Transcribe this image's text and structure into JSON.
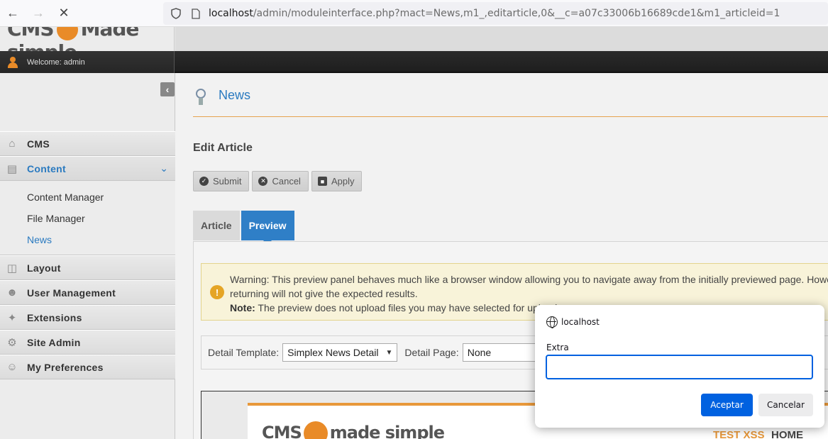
{
  "browser": {
    "url_host": "localhost",
    "url_path": "/admin/moduleinterface.php?mact=News,m1_,editarticle,0&__c=a07c33006b16689cde1&m1_articleid=1",
    "back_icon": "arrow-left-icon",
    "forward_icon": "arrow-right-icon",
    "stop_icon": "close-icon"
  },
  "header": {
    "logo_text_left": "CMS",
    "logo_text_right": "Made simple",
    "welcome": "Welcome: admin"
  },
  "sidebar": {
    "items": [
      {
        "label": "CMS",
        "icon": "home-icon"
      },
      {
        "label": "Content",
        "icon": "content-icon"
      },
      {
        "label": "Layout",
        "icon": "layout-icon"
      },
      {
        "label": "User Management",
        "icon": "users-icon"
      },
      {
        "label": "Extensions",
        "icon": "puzzle-icon"
      },
      {
        "label": "Site Admin",
        "icon": "gear-icon"
      },
      {
        "label": "My Preferences",
        "icon": "user-icon"
      }
    ],
    "content_sub": [
      "Content Manager",
      "File Manager",
      "News"
    ]
  },
  "main": {
    "page_title": "News",
    "section_title": "Edit Article",
    "buttons": {
      "submit": "Submit",
      "cancel": "Cancel",
      "apply": "Apply"
    },
    "tabs": [
      "Article",
      "Preview"
    ],
    "warning": {
      "line1": "Warning: This preview panel behaves much like a browser window allowing you to navigate away from the initially previewed page. However",
      "line2": "returning will not give the expected results.",
      "note_label": "Note:",
      "note_text": " The preview does not upload files you may have selected for upload."
    },
    "detail_template_label": "Detail Template:",
    "detail_template_value": "Simplex News Detail",
    "detail_page_label": "Detail Page:",
    "detail_page_value": "None",
    "preview": {
      "logo_left": "CMS",
      "logo_right": "made simple",
      "link1": "TEST XSS",
      "link2": "HOME"
    }
  },
  "dialog": {
    "origin": "localhost",
    "label": "Extra",
    "input_value": "",
    "ok": "Aceptar",
    "cancel": "Cancelar"
  }
}
